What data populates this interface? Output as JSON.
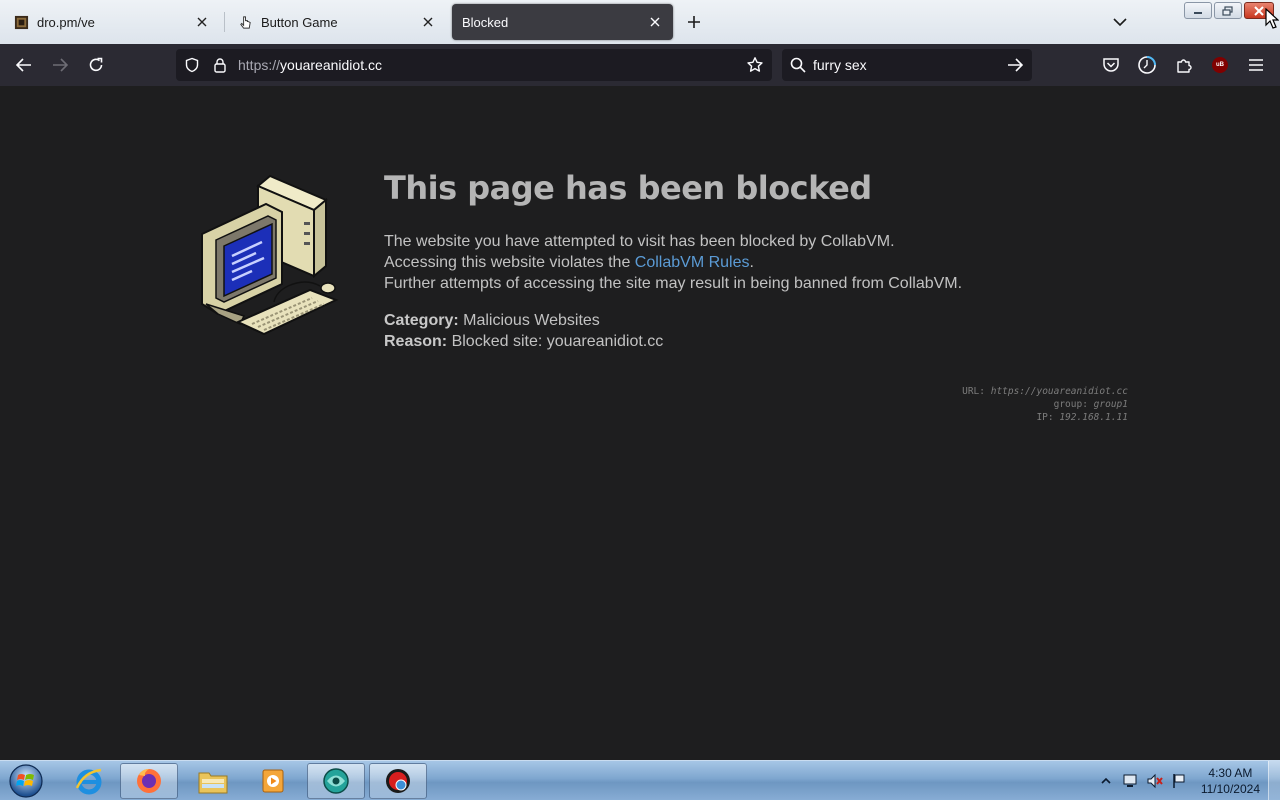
{
  "tabs": [
    {
      "title": "dro.pm/ve",
      "active": false
    },
    {
      "title": "Button Game",
      "active": false
    },
    {
      "title": "Blocked",
      "active": true
    }
  ],
  "toolbar": {
    "url_scheme": "https://",
    "url_host": "youareanidiot.cc",
    "search_query": "furry sex",
    "ublock_badge": "uB"
  },
  "page": {
    "heading": "This page has been blocked",
    "line1": "The website you have attempted to visit has been blocked by CollabVM.",
    "line2_before": "Accessing this website violates the ",
    "line2_link": "CollabVM Rules",
    "line2_after": ".",
    "line3": "Further attempts of accessing the site may result in being banned from CollabVM.",
    "category_label": "Category:",
    "category_value": "Malicious Websites",
    "reason_label": "Reason:",
    "reason_value": "Blocked site: youareanidiot.cc",
    "debug": {
      "url_label": "URL:",
      "url_value": "https://youareanidiot.cc",
      "group_label": "group:",
      "group_value": "group1",
      "ip_label": "IP:",
      "ip_value": "192.168.1.11"
    }
  },
  "taskbar": {
    "time": "4:30 AM",
    "date": "11/10/2024"
  },
  "colors": {
    "page_bg": "#1e1e1f",
    "heading": "#b5b5b5",
    "link": "#5b9bd5",
    "toolbar_bg": "#2b2a33",
    "active_tab": "#3b3b41"
  }
}
